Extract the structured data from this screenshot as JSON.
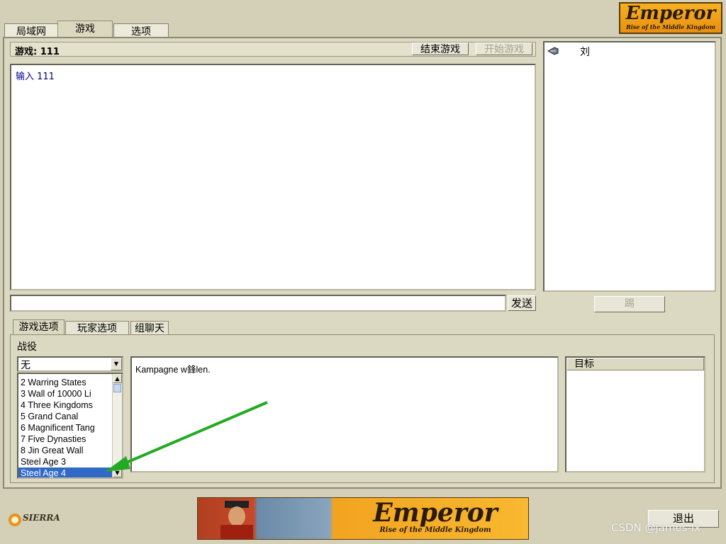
{
  "top_tabs": [
    {
      "label": "局域网"
    },
    {
      "label": "游戏"
    },
    {
      "label": "选项"
    }
  ],
  "logo_top": {
    "title": "Emperor",
    "subtitle": "Rise of the Middle Kingdom"
  },
  "game": {
    "header_label": "游戏: 111",
    "end_game_label": "结束游戏",
    "start_game_label": "开始游戏",
    "chat_log": [
      "输入 111"
    ],
    "send_label": "发送",
    "chat_input_value": ""
  },
  "players": {
    "items": [
      {
        "name": "刘",
        "icon": "player-flag-icon"
      }
    ],
    "kick_label": "踢"
  },
  "sub_tabs": [
    {
      "label": "游戏选项"
    },
    {
      "label": "玩家选项"
    },
    {
      "label": "组聊天"
    }
  ],
  "campaign": {
    "label": "战役",
    "selected_value": "无",
    "list_items": [
      "2 Warring States",
      "3 Wall of 10000 Li",
      "4 Three Kingdoms",
      "5 Grand Canal",
      "6 Magnificent Tang",
      "7 Five Dynasties",
      "8 Jin Great Wall",
      "Steel Age 3",
      "Steel Age 4"
    ],
    "selected_index": 8,
    "description": "Kampagne w鋒len.",
    "goal_header": "目标"
  },
  "footer": {
    "sierra_label": "SIERRA",
    "banner_title": "Emperor",
    "banner_subtitle": "Rise of the Middle Kingdom",
    "exit_label": "退出",
    "watermark": "CSDN @james-lx"
  },
  "colors": {
    "background": "#d4d0b8",
    "selection": "#3169c6",
    "link_text": "#00008b",
    "arrow": "#22aa22"
  }
}
